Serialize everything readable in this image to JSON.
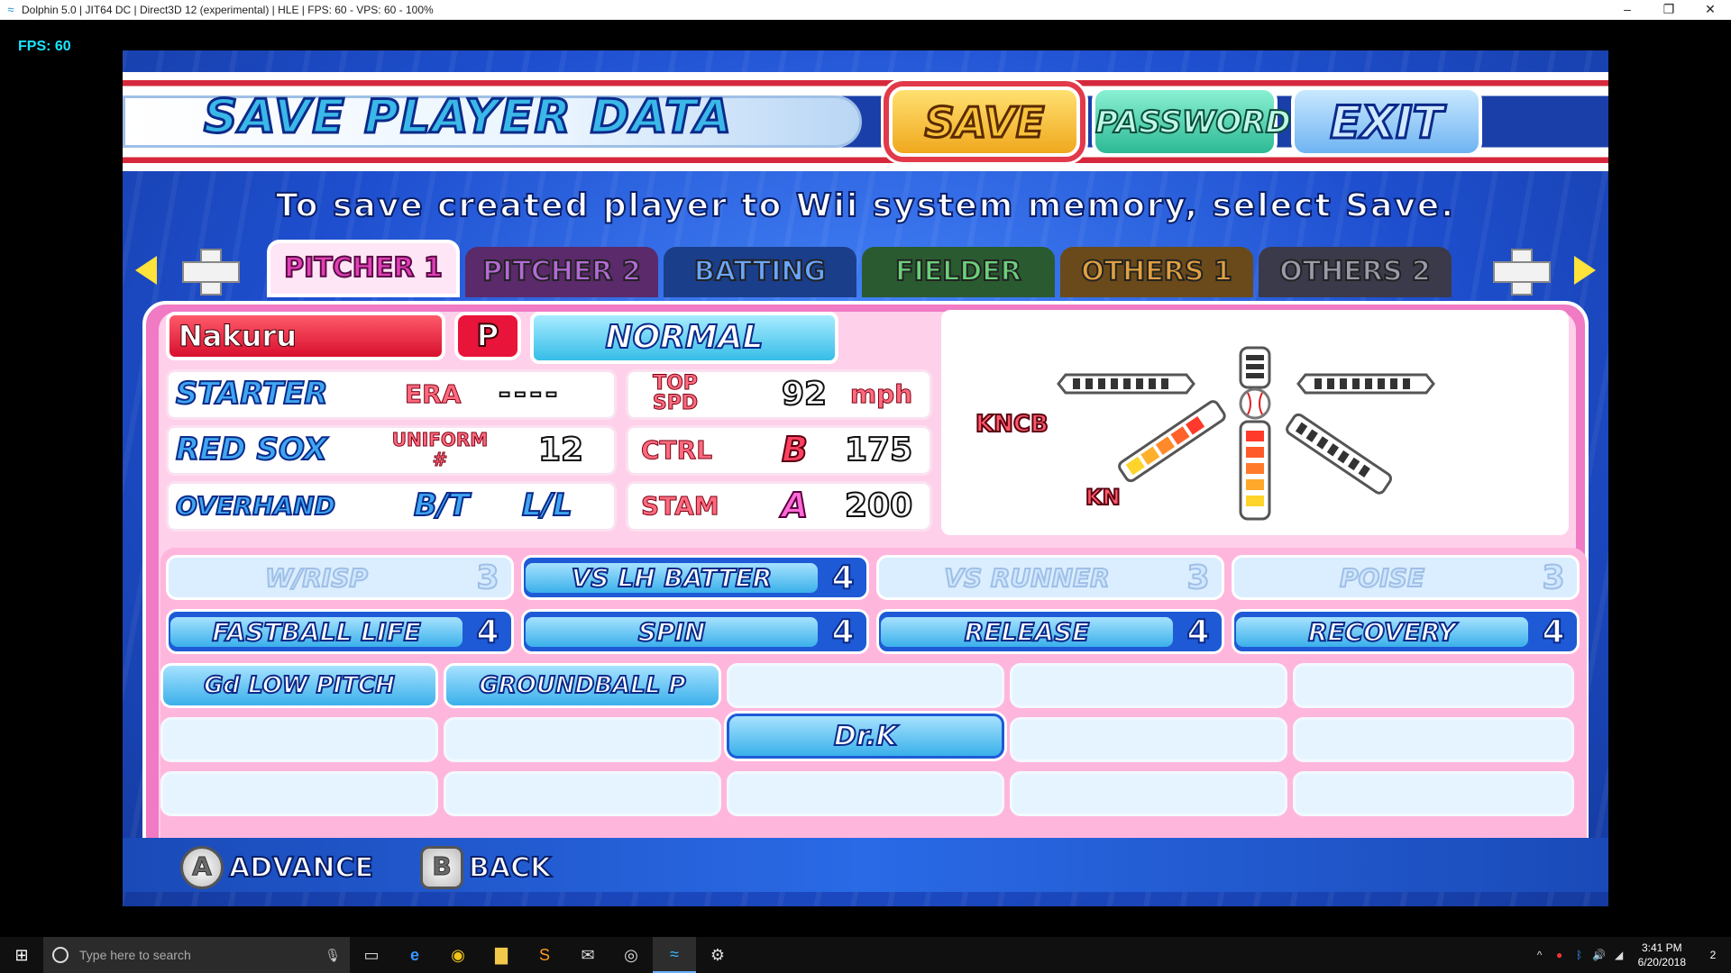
{
  "window": {
    "title": "Dolphin 5.0 | JIT64 DC | Direct3D 12 (experimental) | HLE | FPS: 60 - VPS: 60 - 100%",
    "minimize": "–",
    "maximize": "❐",
    "close": "✕"
  },
  "overlay": {
    "fps": "FPS: 60"
  },
  "header": {
    "title": "SAVE PLAYER DATA",
    "save": "SAVE",
    "password": "PASSWORD",
    "exit": "EXIT"
  },
  "instruction": "To save created player to Wii system memory, select Save.",
  "tabs": [
    "PITCHER 1",
    "PITCHER 2",
    "BATTING",
    "FIELDER",
    "OTHERS 1",
    "OTHERS 2"
  ],
  "player": {
    "name": "Nakuru",
    "position": "P",
    "type": "NORMAL",
    "role": "STARTER",
    "era_label": "ERA",
    "era_value": "----",
    "team": "RED SOX",
    "uniform_label": "UNIFORM #",
    "uniform": "12",
    "delivery": "OVERHAND",
    "bt_label": "B/T",
    "bt": "L/L",
    "top_spd_label": "TOP SPD",
    "top_spd": "92",
    "speed_unit": "mph",
    "ctrl_label": "CTRL",
    "ctrl_grade": "B",
    "ctrl": "175",
    "stam_label": "STAM",
    "stam_grade": "A",
    "stam": "200"
  },
  "pitch_chart": {
    "left_label": "KNCB",
    "bottom_label": "KN",
    "slider_level": 0,
    "curve_level": 5,
    "fork_level": 5,
    "shoot_level": 0,
    "sink_level": 0
  },
  "abilities": {
    "row1": [
      {
        "name": "W/RISP",
        "level": "3",
        "state": "dim"
      },
      {
        "name": "VS LH BATTER",
        "level": "4",
        "state": "on"
      },
      {
        "name": "VS RUNNER",
        "level": "3",
        "state": "dim"
      },
      {
        "name": "POISE",
        "level": "3",
        "state": "dim"
      }
    ],
    "row2": [
      {
        "name": "FASTBALL LIFE",
        "level": "4"
      },
      {
        "name": "SPIN",
        "level": "4"
      },
      {
        "name": "RELEASE",
        "level": "4"
      },
      {
        "name": "RECOVERY",
        "level": "4"
      }
    ],
    "specials": [
      "Gd LOW PITCH",
      "GROUNDBALL P",
      "Dr.K"
    ]
  },
  "footer": {
    "a_key": "A",
    "advance": "ADVANCE",
    "b_key": "B",
    "back": "BACK"
  },
  "taskbar": {
    "search_placeholder": "Type here to search",
    "time": "3:41 PM",
    "date": "6/20/2018",
    "notifications": "2"
  }
}
